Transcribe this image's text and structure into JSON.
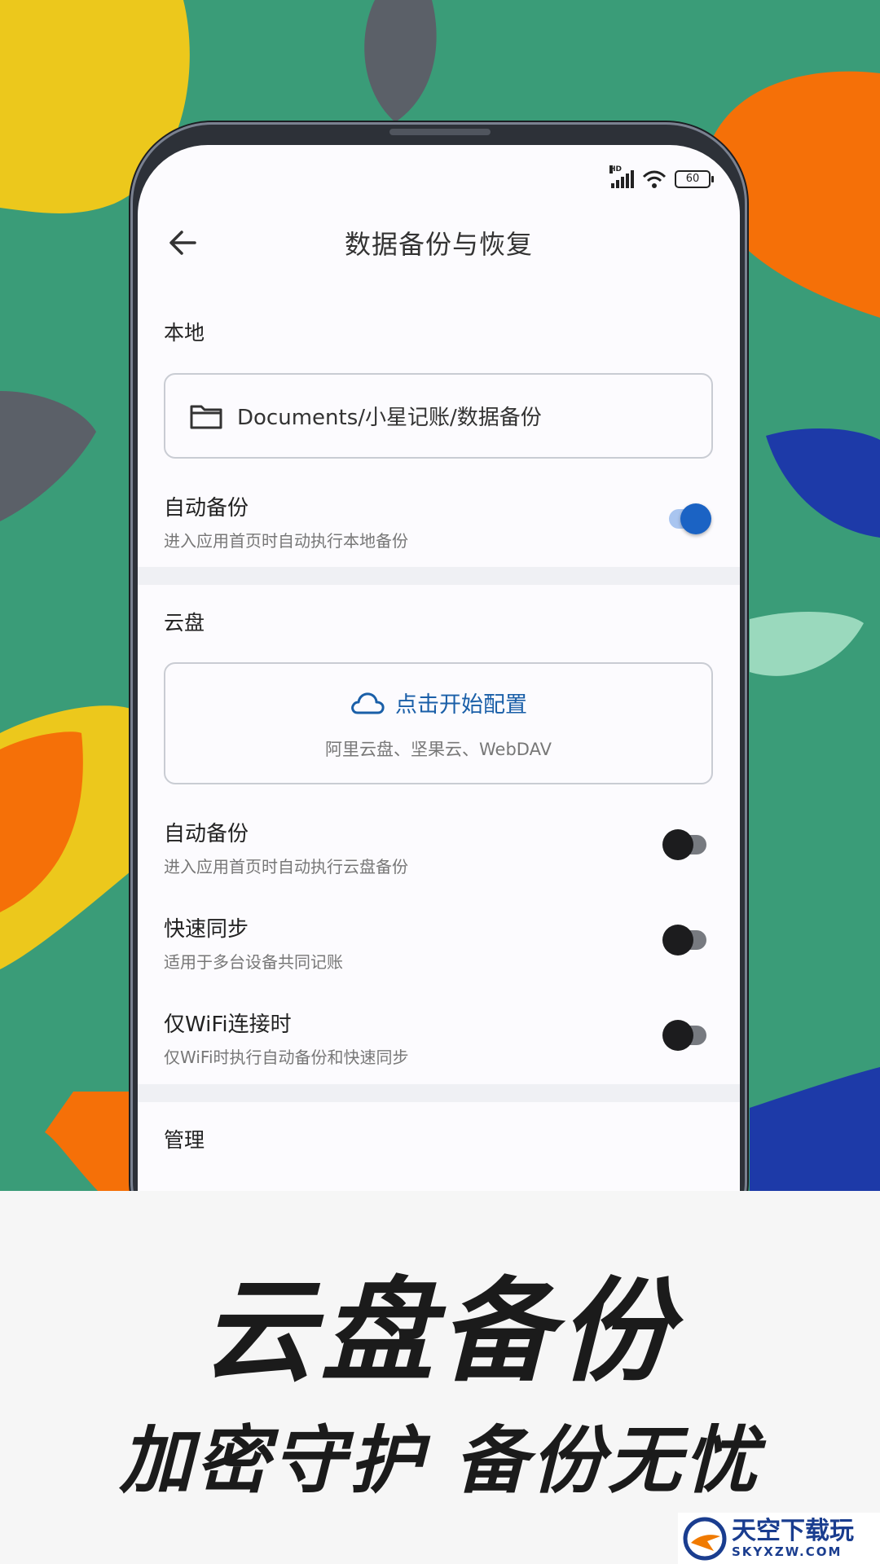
{
  "status_bar": {
    "network": "HD",
    "battery": "60"
  },
  "header": {
    "title": "数据备份与恢复"
  },
  "local": {
    "section_title": "本地",
    "path": "Documents/小星记账/数据备份",
    "auto_backup": {
      "label": "自动备份",
      "desc": "进入应用首页时自动执行本地备份",
      "enabled": true
    }
  },
  "cloud": {
    "section_title": "云盘",
    "configure_label": "点击开始配置",
    "providers": "阿里云盘、坚果云、WebDAV",
    "auto_backup": {
      "label": "自动备份",
      "desc": "进入应用首页时自动执行云盘备份",
      "enabled": false
    },
    "quick_sync": {
      "label": "快速同步",
      "desc": "适用于多台设备共同记账",
      "enabled": false
    },
    "wifi_only": {
      "label": "仅WiFi连接时",
      "desc": "仅WiFi时执行自动备份和快速同步",
      "enabled": false
    }
  },
  "manage": {
    "section_title": "管理"
  },
  "promo": {
    "headline": "云盘备份",
    "subline": "加密守护  备份无忧"
  },
  "watermark": {
    "brand_cn": "天空下载玩",
    "brand_en": "SKYXZW.COM"
  },
  "colors": {
    "background": "#3a9c78",
    "accent": "#1b63c4",
    "link": "#1a5fa8"
  }
}
